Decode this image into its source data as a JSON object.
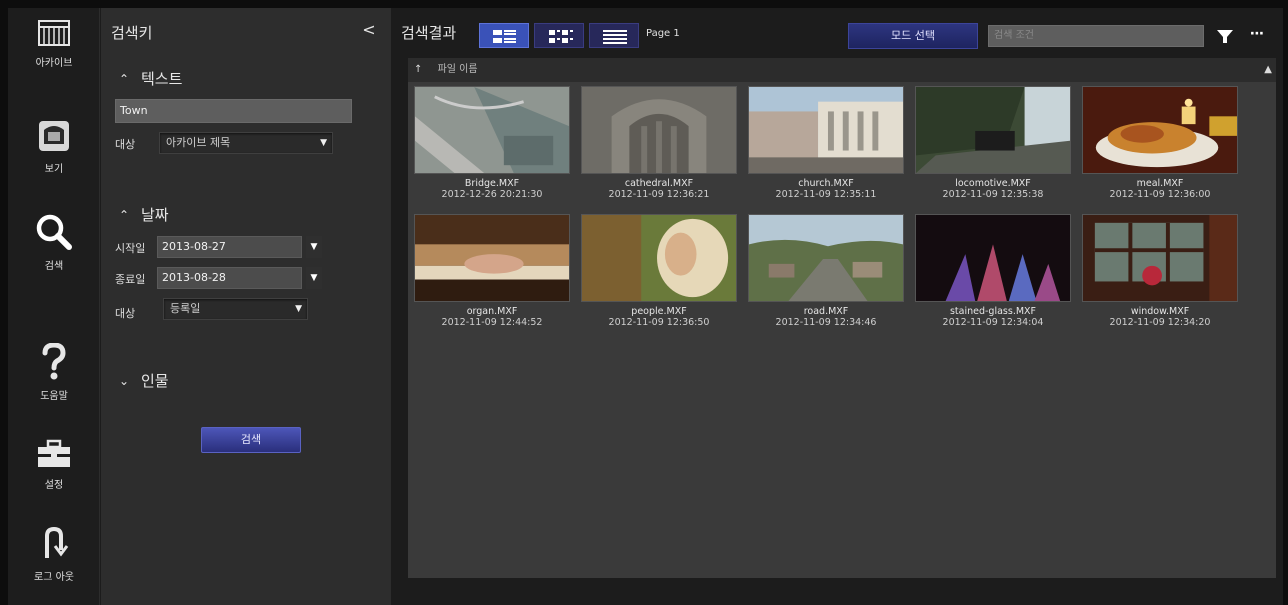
{
  "nav": {
    "items": [
      {
        "label": "아카이브",
        "icon": "archive-icon"
      },
      {
        "label": "보기",
        "icon": "view-icon"
      },
      {
        "label": "검색",
        "icon": "search-icon"
      },
      {
        "label": "도움말",
        "icon": "help-icon"
      },
      {
        "label": "설정",
        "icon": "toolbox-icon"
      },
      {
        "label": "로그 아웃",
        "icon": "logout-icon"
      }
    ]
  },
  "search_keys": {
    "title": "검색키",
    "collapse_glyph": "<",
    "text_section": {
      "header": "텍스트",
      "value": "Town",
      "target_label": "대상",
      "target_value": "아카이브 제목"
    },
    "date_section": {
      "header": "날짜",
      "start_label": "시작일",
      "start_value": "2013-08-27",
      "end_label": "종료일",
      "end_value": "2013-08-28",
      "target_label": "대상",
      "target_value": "등록일"
    },
    "people_section": {
      "header": "인물"
    },
    "search_button": "검색"
  },
  "results": {
    "title": "검색결과",
    "page_label": "Page 1",
    "mode_button": "모드 선택",
    "search_placeholder": "검색 조건",
    "header_sort": "↑",
    "header_column": "파일 이름",
    "header_corner": "▲",
    "items": [
      {
        "name": "Bridge.MXF",
        "date": "2012-12-26 20:21:30"
      },
      {
        "name": "cathedral.MXF",
        "date": "2012-11-09 12:36:21"
      },
      {
        "name": "church.MXF",
        "date": "2012-11-09 12:35:11"
      },
      {
        "name": "locomotive.MXF",
        "date": "2012-11-09 12:35:38"
      },
      {
        "name": "meal.MXF",
        "date": "2012-11-09 12:36:00"
      },
      {
        "name": "organ.MXF",
        "date": "2012-11-09 12:44:52"
      },
      {
        "name": "people.MXF",
        "date": "2012-11-09 12:36:50"
      },
      {
        "name": "road.MXF",
        "date": "2012-11-09 12:34:46"
      },
      {
        "name": "stained-glass.MXF",
        "date": "2012-11-09 12:34:04"
      },
      {
        "name": "window.MXF",
        "date": "2012-11-09 12:34:20"
      }
    ]
  },
  "colors": {
    "accent": "#3a52b8",
    "panel": "#2d2d2d",
    "grid": "#3a3a3a"
  }
}
